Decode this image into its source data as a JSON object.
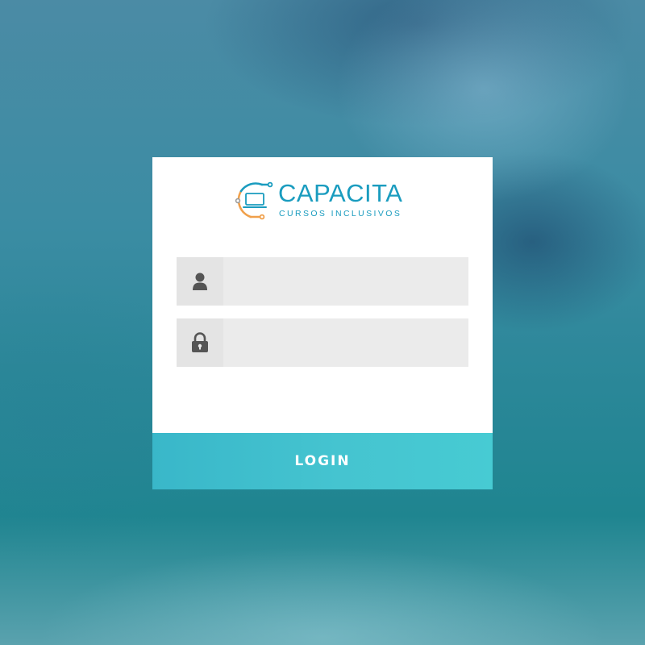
{
  "brand": {
    "name": "CAPACITA",
    "tagline": "CURSOS INCLUSIVOS",
    "colors": {
      "primary": "#1a9cbf",
      "accent": "#f0a04b"
    }
  },
  "form": {
    "username": {
      "icon": "user-icon",
      "value": "",
      "placeholder": ""
    },
    "password": {
      "icon": "lock-icon",
      "value": "",
      "placeholder": ""
    },
    "submit_label": "LOGIN",
    "submit_color": "#45c4d0"
  }
}
